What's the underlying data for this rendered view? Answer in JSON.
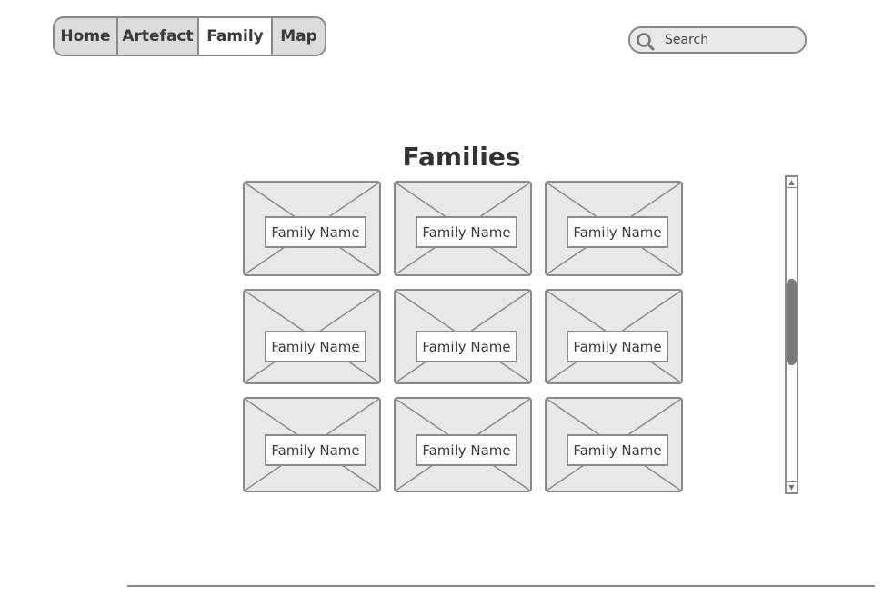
{
  "nav": {
    "tabs": [
      {
        "label": "Home"
      },
      {
        "label": "Artefact"
      },
      {
        "label": "Family"
      },
      {
        "label": "Map"
      }
    ],
    "active_tab": "Family"
  },
  "search": {
    "placeholder": "Search",
    "icon": "search-icon"
  },
  "page": {
    "title": "Families"
  },
  "cards": [
    {
      "label": "Family Name"
    },
    {
      "label": "Family Name"
    },
    {
      "label": "Family Name"
    },
    {
      "label": "Family Name"
    },
    {
      "label": "Family Name"
    },
    {
      "label": "Family Name"
    },
    {
      "label": "Family Name"
    },
    {
      "label": "Family Name"
    },
    {
      "label": "Family Name"
    }
  ],
  "colors": {
    "border": "#8a8a8a",
    "fill": "#e8e8e8",
    "active_tab": "#ffffff",
    "tab": "#dcdcdc"
  }
}
